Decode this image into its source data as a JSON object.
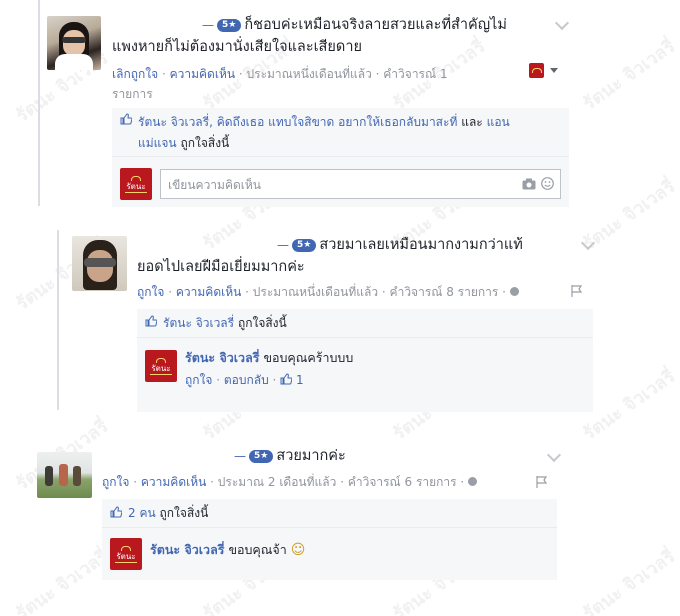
{
  "watermark": "รัตนะ จิวเวลรี่",
  "comments": [
    {
      "dash": "—",
      "rating": "5★",
      "text_line1": "ก็ชอบค่ะเหมือนจริงลายสวยและที่สำคัญไม่",
      "text_line2": "แพงหายก็ไม่ต้องมานั่งเสียใจและเสียดาย",
      "meta_like": "เลิกถูกใจ",
      "meta_comment": "ความคิดเห็น",
      "meta_time": "ประมาณหนึ่งเดือนที่แล้ว",
      "meta_replies_a": "คำวิจารณ์ 1",
      "meta_replies_b": "รายการ",
      "likers": "รัตนะ จิวเวลรี่, คิดถึงเธอ แทบใจสิขาด อยากให้เธอกลับมาสะที่",
      "likers_and": "และ",
      "likers_last": "แอน",
      "likers_line2_name": "แม่แจน",
      "likers_suffix": "ถูกใจสิ่งนี้",
      "input_placeholder": "เขียนความคิดเห็น"
    },
    {
      "dash": "—",
      "rating": "5★",
      "text_line1": "สวยมาเลยเหมือนมากงามกว่าแท้",
      "text_line2": "ยอดไปเลยฝีมือเยี่ยมมากค่ะ",
      "meta_like": "ถูกใจ",
      "meta_comment": "ความคิดเห็น",
      "meta_time": "ประมาณหนึ่งเดือนที่แล้ว",
      "meta_replies": "คำวิจารณ์ 8 รายการ",
      "likers": "รัตนะ จิวเวลรี่",
      "likers_suffix": "ถูกใจสิ่งนี้",
      "reply_author": "รัตนะ จิวเวลรี่",
      "reply_text": "ขอบคุณคร้าบบบ",
      "reply_like": "ถูกใจ",
      "reply_reply": "ตอบกลับ",
      "reply_count": "1"
    },
    {
      "dash": "—",
      "rating": "5★",
      "text_line1": "สวยมากค่ะ",
      "meta_like": "ถูกใจ",
      "meta_comment": "ความคิดเห็น",
      "meta_time": "ประมาณ 2 เดือนที่แล้ว",
      "meta_replies": "คำวิจารณ์ 6 รายการ",
      "likes_count": "2 คน",
      "likers_suffix": "ถูกใจสิ่งนี้",
      "reply_author": "รัตนะ จิวเวลรี่",
      "reply_text": "ขอบคุณจ้า",
      "reply_emoji": "☺"
    }
  ],
  "logo_text": "รัตนะ",
  "colors": {
    "link": "#4267b2",
    "muted": "#90949c",
    "brand": "#b9181f",
    "panel": "#f6f7f9"
  }
}
